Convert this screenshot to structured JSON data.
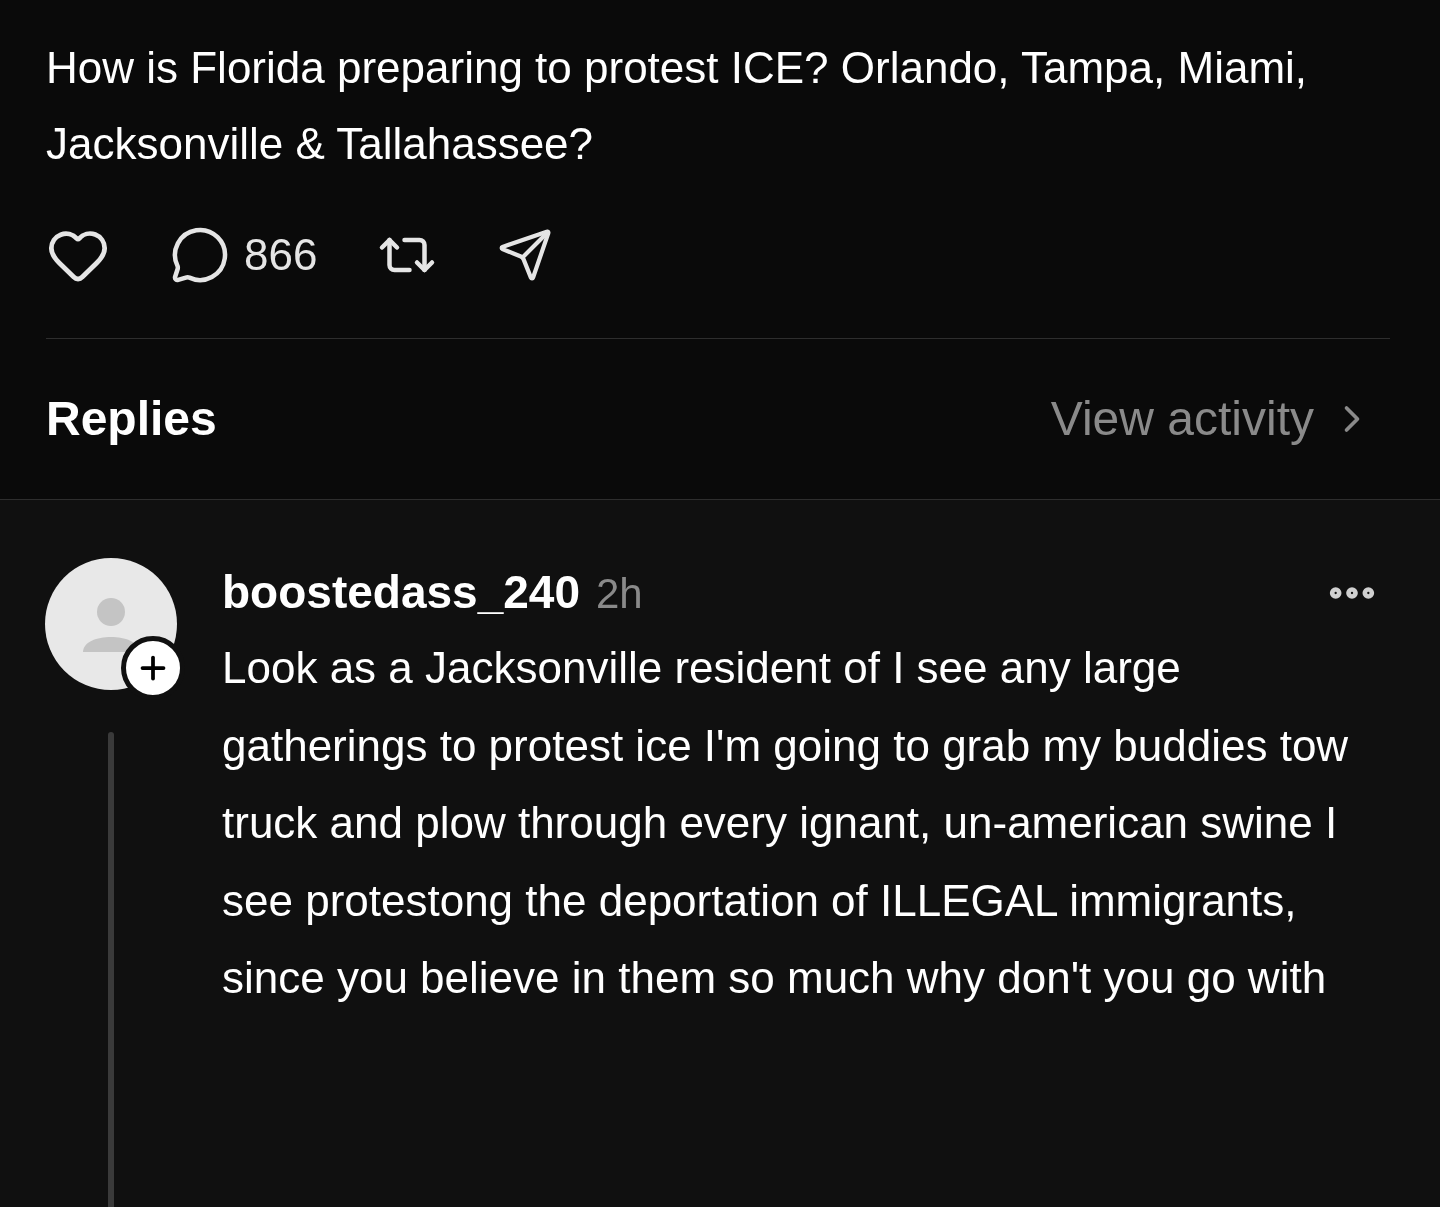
{
  "post": {
    "text": "How is Florida preparing to protest ICE? Orlando, Tampa, Miami, Jacksonville & Tallahassee?",
    "comment_count": "866"
  },
  "replies_header": {
    "title": "Replies",
    "link": "View activity"
  },
  "replies": [
    {
      "username": "boostedass_240",
      "time": "2h",
      "text": "Look as a Jacksonville resident of I see any large gatherings to protest ice I'm going to grab my buddies tow truck and plow through every ignant, un-american swine I see protestong the deportation of ILLEGAL immigrants, since you believe in them so much why don't you go with"
    }
  ]
}
